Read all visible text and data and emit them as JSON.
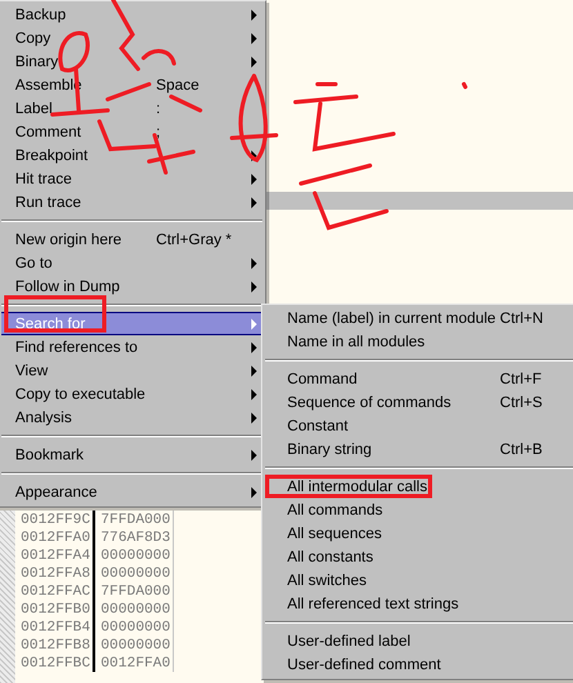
{
  "context_menu": {
    "items": [
      {
        "kind": "item",
        "label": "Backup",
        "submenu": true,
        "selected": false
      },
      {
        "kind": "item",
        "label": "Copy",
        "submenu": true,
        "selected": false
      },
      {
        "kind": "item",
        "label": "Binary",
        "submenu": true,
        "selected": false
      },
      {
        "kind": "item",
        "label": "Assemble",
        "shortcut": "Space",
        "selected": false
      },
      {
        "kind": "item",
        "label": "Label",
        "shortcut": ":",
        "selected": false
      },
      {
        "kind": "item",
        "label": "Comment",
        "shortcut": ";",
        "selected": false
      },
      {
        "kind": "item",
        "label": "Breakpoint",
        "submenu": true,
        "selected": false
      },
      {
        "kind": "item",
        "label": "Hit trace",
        "submenu": true,
        "selected": false
      },
      {
        "kind": "item",
        "label": "Run trace",
        "submenu": true,
        "selected": false
      },
      {
        "kind": "separator"
      },
      {
        "kind": "item",
        "label": "New origin here",
        "shortcut": "Ctrl+Gray *",
        "selected": false
      },
      {
        "kind": "item",
        "label": "Go to",
        "submenu": true,
        "selected": false
      },
      {
        "kind": "item",
        "label": "Follow in Dump",
        "submenu": true,
        "selected": false
      },
      {
        "kind": "separator"
      },
      {
        "kind": "item",
        "label": "Search for",
        "submenu": true,
        "selected": true,
        "circled": true
      },
      {
        "kind": "item",
        "label": "Find references to",
        "submenu": true,
        "selected": false
      },
      {
        "kind": "item",
        "label": "View",
        "submenu": true,
        "selected": false
      },
      {
        "kind": "item",
        "label": "Copy to executable",
        "submenu": true,
        "selected": false
      },
      {
        "kind": "item",
        "label": "Analysis",
        "submenu": true,
        "selected": false
      },
      {
        "kind": "separator"
      },
      {
        "kind": "item",
        "label": "Bookmark",
        "submenu": true,
        "selected": false
      },
      {
        "kind": "separator"
      },
      {
        "kind": "item",
        "label": "Appearance",
        "submenu": true,
        "selected": false
      }
    ]
  },
  "search_submenu": {
    "items": [
      {
        "kind": "item",
        "label": "Name (label) in current module",
        "shortcut": "Ctrl+N",
        "selected": false
      },
      {
        "kind": "item",
        "label": "Name in all modules",
        "selected": false
      },
      {
        "kind": "separator"
      },
      {
        "kind": "item",
        "label": "Command",
        "shortcut": "Ctrl+F",
        "selected": false
      },
      {
        "kind": "item",
        "label": "Sequence of commands",
        "shortcut": "Ctrl+S",
        "selected": false
      },
      {
        "kind": "item",
        "label": "Constant",
        "selected": false
      },
      {
        "kind": "item",
        "label": "Binary string",
        "shortcut": "Ctrl+B",
        "selected": false
      },
      {
        "kind": "separator"
      },
      {
        "kind": "item",
        "label": "All intermodular calls",
        "selected": false,
        "circled": true
      },
      {
        "kind": "item",
        "label": "All commands",
        "selected": false
      },
      {
        "kind": "item",
        "label": "All sequences",
        "selected": false
      },
      {
        "kind": "item",
        "label": "All constants",
        "selected": false
      },
      {
        "kind": "item",
        "label": "All switches",
        "selected": false
      },
      {
        "kind": "item",
        "label": "All referenced text strings",
        "selected": false
      },
      {
        "kind": "separator"
      },
      {
        "kind": "item",
        "label": "User-defined label",
        "selected": false
      },
      {
        "kind": "item",
        "label": "User-defined comment",
        "selected": false
      }
    ]
  },
  "stack": {
    "rows": [
      {
        "address": "0012FF9C",
        "value": "7FFDA000"
      },
      {
        "address": "0012FFA0",
        "value": "776AF8D3"
      },
      {
        "address": "0012FFA4",
        "value": "00000000"
      },
      {
        "address": "0012FFA8",
        "value": "00000000"
      },
      {
        "address": "0012FFAC",
        "value": "7FFDA000"
      },
      {
        "address": "0012FFB0",
        "value": "00000000"
      },
      {
        "address": "0012FFB4",
        "value": "00000000"
      },
      {
        "address": "0012FFB8",
        "value": "00000000"
      },
      {
        "address": "0012FFBC",
        "value": "0012FFA0"
      }
    ]
  }
}
